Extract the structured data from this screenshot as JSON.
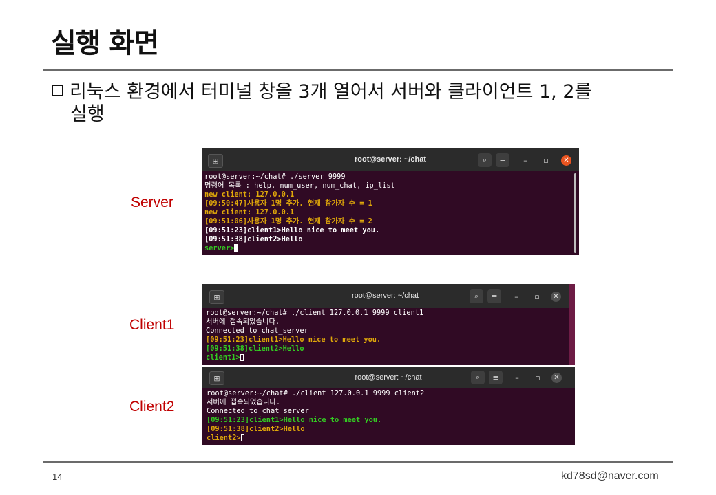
{
  "slide": {
    "title": "실행 화면",
    "bullet_line1": "리눅스 환경에서 터미널 창을 3개 열어서 서버와 클라이언트 1, 2를",
    "bullet_line2": "실행",
    "page_number": "14",
    "email": "kd78sd@naver.com"
  },
  "labels": {
    "server": "Server",
    "client1": "Client1",
    "client2": "Client2"
  },
  "colors": {
    "terminal_bg": "#300a24",
    "titlebar_bg": "#2b2b2b",
    "close_button": "#e95420",
    "label_red": "#c00000",
    "text_yellow": "#e0a80a",
    "text_green": "#33cc22"
  },
  "icons": {
    "new_tab": "new-tab-icon",
    "search": "search-icon",
    "menu": "hamburger-menu-icon",
    "minimize": "minimize-icon",
    "maximize": "maximize-icon",
    "close": "close-icon"
  },
  "server_window": {
    "title": "root@server: ~/chat",
    "prompt_cmd": "root@server:~/chat# ./server 9999",
    "line_help": "명령어 목록 : help, num_user, num_chat, ip_list",
    "line_new1": "new client: 127.0.0.1",
    "line_join1": "[09:50:47]사용자 1명 추가. 현재 참가자 수 = 1",
    "line_new2": "new client: 127.0.0.1",
    "line_join2": "[09:51:06]사용자 1명 추가. 현재 참가자 수 = 2",
    "line_msg1": "[09:51:23]client1>Hello nice to meet you.",
    "line_msg2": "[09:51:38]client2>Hello",
    "prompt": "server>"
  },
  "client1_window": {
    "title": "root@server: ~/chat",
    "prompt_cmd": "root@server:~/chat# ./client 127.0.0.1 9999 client1",
    "line_connected_kr": "서버에 접속되었습니다.",
    "line_connected": "Connected to chat_server",
    "line_msg1": "[09:51:23]client1>Hello nice to meet you.",
    "msg2_time": "[09:51:38]",
    "msg2_text": "client2>Hello",
    "prompt": "client1>"
  },
  "client2_window": {
    "title": "root@server: ~/chat",
    "prompt_cmd": "root@server:~/chat# ./client 127.0.0.1 9999 client2",
    "line_connected_kr": "서버에 접속되었습니다.",
    "line_connected": "Connected to chat_server",
    "line_msg1": "[09:51:23]client1>Hello nice to meet you.",
    "msg2_time": "[09:51:38]",
    "msg2_text": "client2>Hello",
    "prompt": "client2>"
  }
}
